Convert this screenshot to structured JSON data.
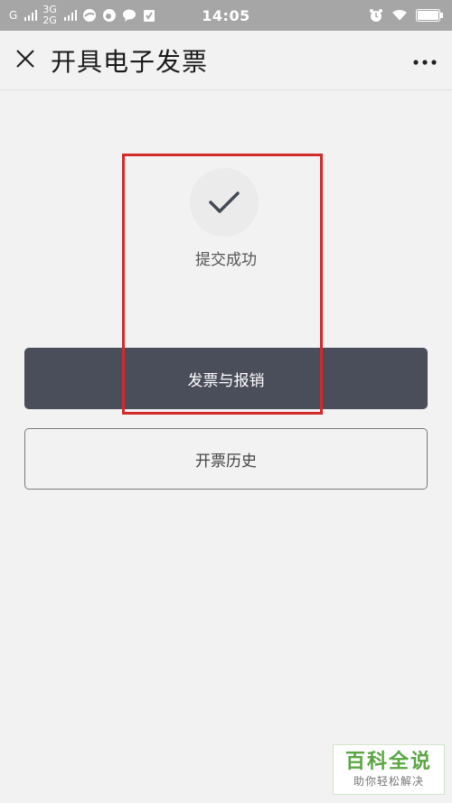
{
  "status_bar": {
    "network_1": "G",
    "network_2_top": "3G",
    "network_2_bottom": "2G",
    "time": "14:05"
  },
  "header": {
    "title": "开具电子发票"
  },
  "main": {
    "success_text": "提交成功",
    "primary_button_label": "发票与报销",
    "secondary_button_label": "开票历史"
  },
  "watermark": {
    "main": "百科全说",
    "sub": "助你轻松解决"
  },
  "colors": {
    "background": "#f2f2f2",
    "status_bar": "#a6a6a6",
    "primary_button": "#4a4d5a",
    "annotation": "#d42a2a",
    "watermark_green": "#5aa642"
  }
}
